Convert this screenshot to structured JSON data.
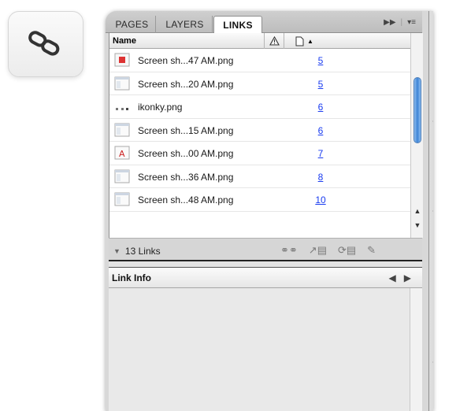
{
  "tabs": [
    "PAGES",
    "LAYERS",
    "LINKS"
  ],
  "columns": {
    "name": "Name"
  },
  "links": [
    {
      "name": "Screen sh...47 AM.png",
      "page": "5",
      "thumb": "png-red"
    },
    {
      "name": "Screen sh...20 AM.png",
      "page": "5",
      "thumb": "png-window"
    },
    {
      "name": "ikonky.png",
      "page": "6",
      "thumb": "png-dots"
    },
    {
      "name": "Screen sh...15 AM.png",
      "page": "6",
      "thumb": "png-window"
    },
    {
      "name": "Screen sh...00 AM.png",
      "page": "7",
      "thumb": "png-pdf"
    },
    {
      "name": "Screen sh...36 AM.png",
      "page": "8",
      "thumb": "png-window"
    },
    {
      "name": "Screen sh...48 AM.png",
      "page": "10",
      "thumb": "png-window"
    }
  ],
  "status": {
    "count": "13 Links"
  },
  "link_info": {
    "title": "Link Info"
  },
  "colors": {
    "link_blue": "#1a3cf0",
    "scroll_thumb": "#3e84d6",
    "panel_bg": "#d8d8d8"
  },
  "toolstrip_icons": [
    "pages-icon",
    "layers-icon",
    "links-icon",
    "character-icon",
    "text-wrap-icon",
    "stroke-icon",
    "gradient-icon",
    "swatches-icon",
    "color-icon",
    "paragraph-styles-icon"
  ]
}
